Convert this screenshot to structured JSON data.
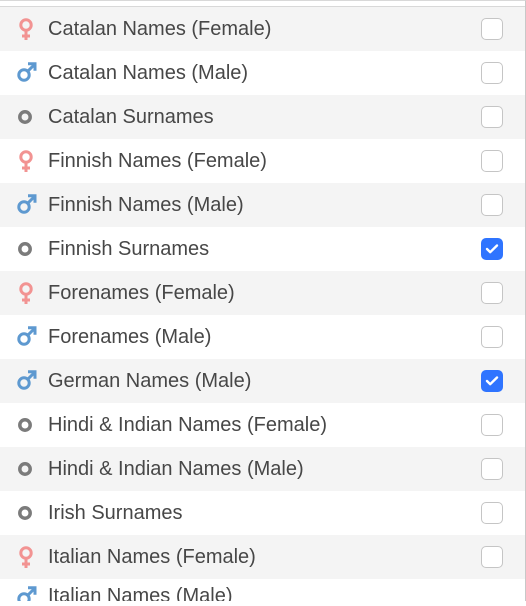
{
  "colors": {
    "female": "#f29392",
    "male": "#5e99d0",
    "neutral": "#7b7b7b",
    "text": "#474747",
    "accent": "#2f74ff"
  },
  "list": {
    "items": [
      {
        "icon": "female",
        "label": "Catalan Names (Female)",
        "checked": false
      },
      {
        "icon": "male",
        "label": "Catalan Names (Male)",
        "checked": false
      },
      {
        "icon": "neutral",
        "label": "Catalan Surnames",
        "checked": false
      },
      {
        "icon": "female",
        "label": "Finnish Names (Female)",
        "checked": false
      },
      {
        "icon": "male",
        "label": "Finnish Names (Male)",
        "checked": false
      },
      {
        "icon": "neutral",
        "label": "Finnish Surnames",
        "checked": true
      },
      {
        "icon": "female",
        "label": "Forenames (Female)",
        "checked": false
      },
      {
        "icon": "male",
        "label": "Forenames (Male)",
        "checked": false
      },
      {
        "icon": "male",
        "label": "German Names (Male)",
        "checked": true
      },
      {
        "icon": "neutral",
        "label": "Hindi & Indian Names (Female)",
        "checked": false
      },
      {
        "icon": "neutral",
        "label": "Hindi & Indian Names (Male)",
        "checked": false
      },
      {
        "icon": "neutral",
        "label": "Irish Surnames",
        "checked": false
      },
      {
        "icon": "female",
        "label": "Italian Names (Female)",
        "checked": false
      },
      {
        "icon": "male",
        "label": "Italian Names (Male)",
        "checked": false,
        "partial": true
      }
    ]
  }
}
